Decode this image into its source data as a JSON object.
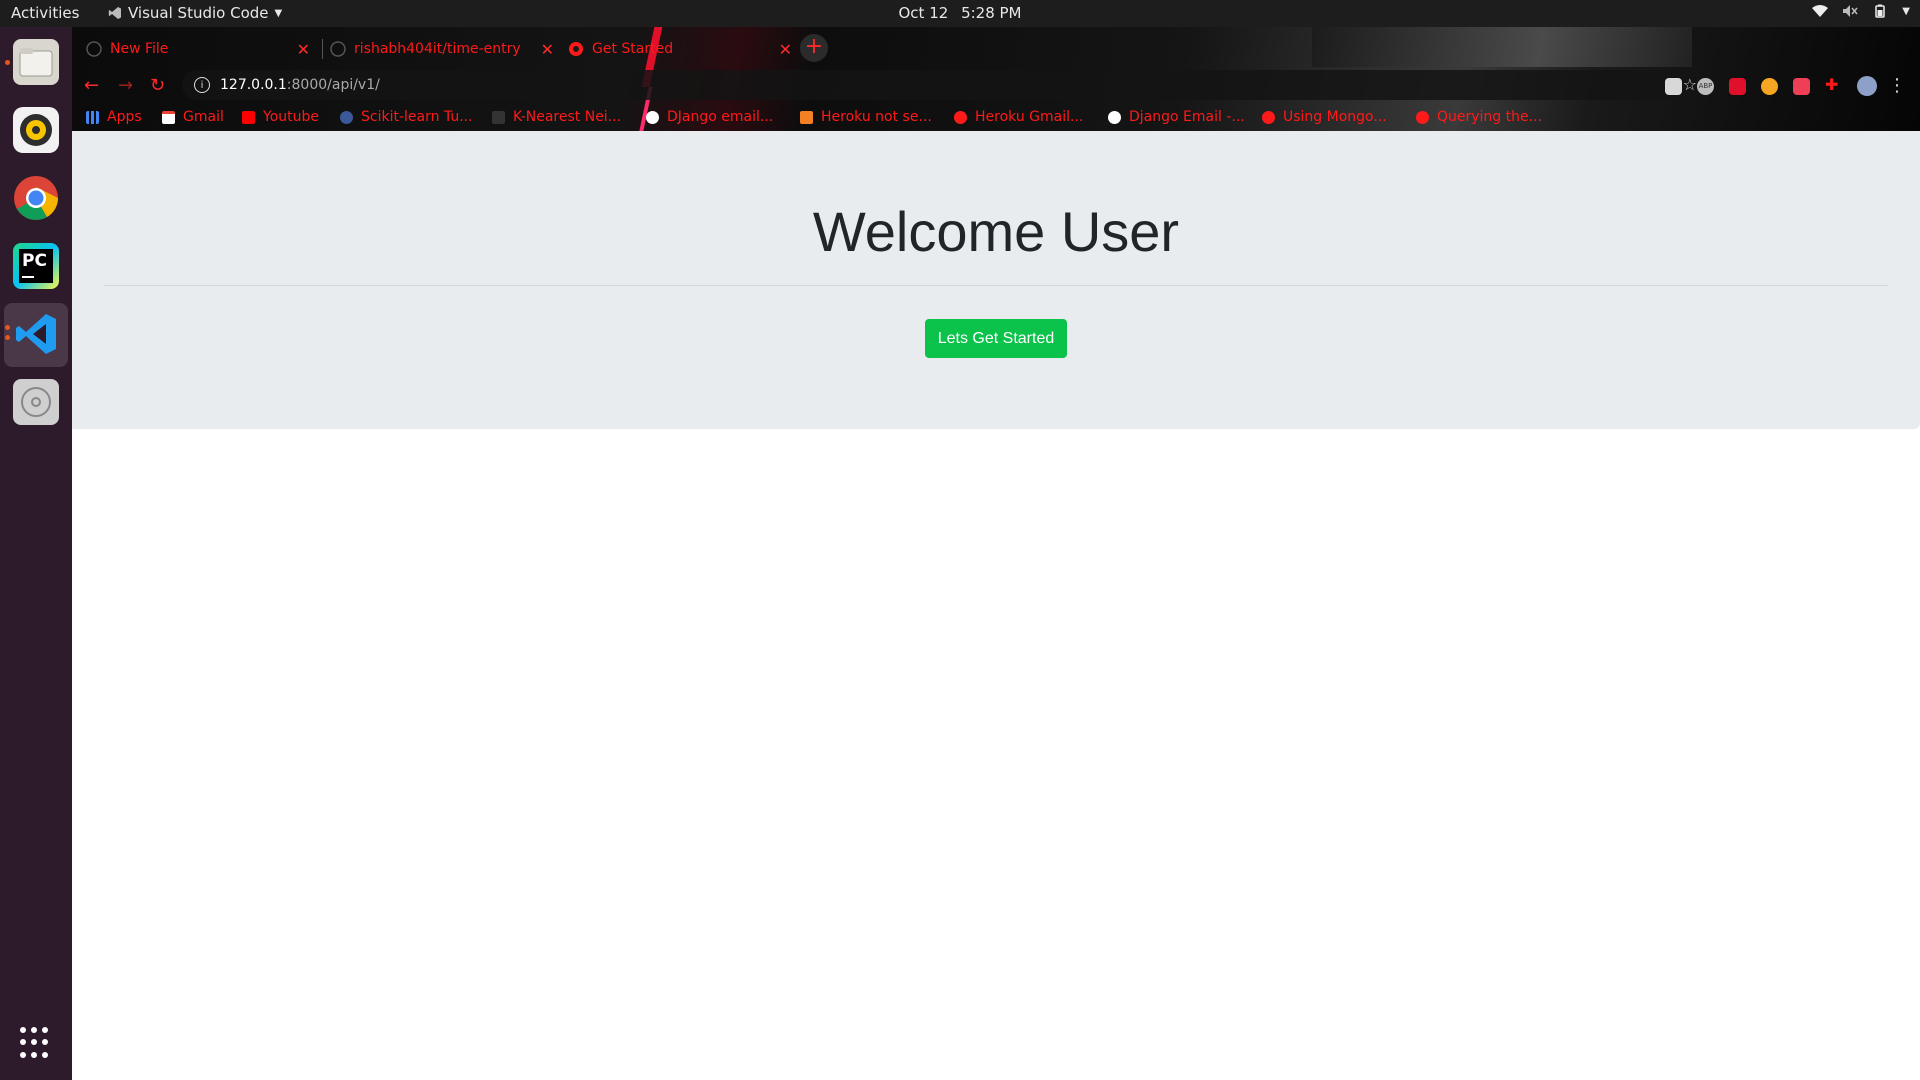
{
  "topbar": {
    "activities": "Activities",
    "app_name": "Visual Studio Code",
    "date": "Oct 12",
    "time": "5:28 PM"
  },
  "dock": {
    "items": [
      "files",
      "rhythmbox",
      "chrome",
      "pycharm",
      "vscode",
      "disc"
    ]
  },
  "tabs": [
    {
      "title": "New File",
      "icon": "github-icon"
    },
    {
      "title": "rishabh404it/time-entry",
      "icon": "github-icon"
    },
    {
      "title": "Get Started",
      "icon": "globe-icon",
      "active": true
    }
  ],
  "address_bar": {
    "host": "127.0.0.1",
    "path": ":8000/api/v1/"
  },
  "bookmarks": [
    {
      "label": "Apps",
      "icon": "apps-grid-icon"
    },
    {
      "label": "Gmail",
      "icon": "gmail-icon"
    },
    {
      "label": "Youtube",
      "icon": "youtube-icon"
    },
    {
      "label": "Scikit-learn Tu...",
      "icon": "scikit-icon"
    },
    {
      "label": "K-Nearest Nei...",
      "icon": "bookmark-icon"
    },
    {
      "label": "DJango email...",
      "icon": "google-icon"
    },
    {
      "label": "Heroku not se...",
      "icon": "stackoverflow-icon"
    },
    {
      "label": "Heroku Gmail...",
      "icon": "globe-icon"
    },
    {
      "label": "Django Email -...",
      "icon": "google-icon"
    },
    {
      "label": "Using Mongo...",
      "icon": "globe-icon"
    },
    {
      "label": "Querying the...",
      "icon": "globe-icon"
    }
  ],
  "page": {
    "heading": "Welcome User",
    "button_label": "Lets Get Started"
  },
  "colors": {
    "accent_red": "#ff1a1a",
    "button_green": "#0bc24a",
    "jumbotron_bg": "#e9ecef"
  }
}
